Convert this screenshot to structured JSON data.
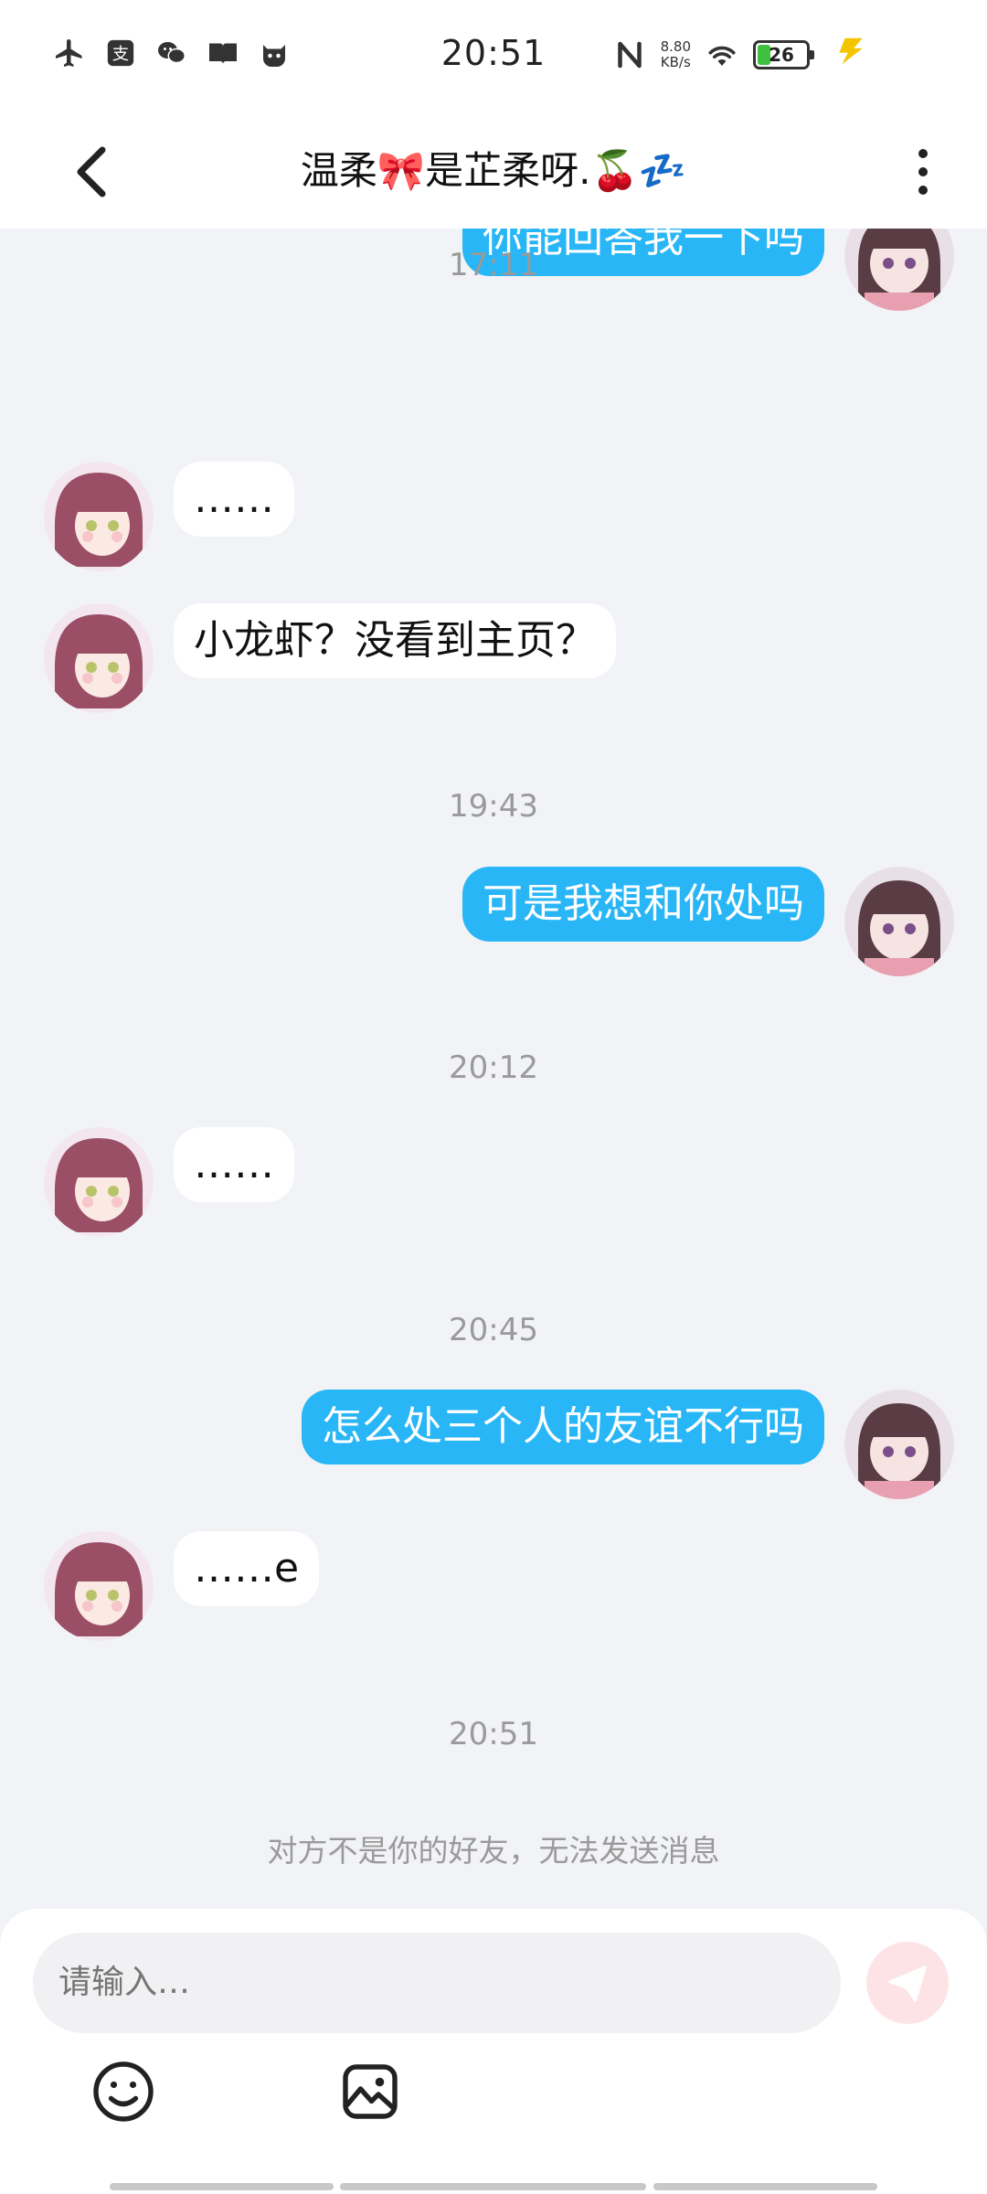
{
  "status_bar": {
    "time": "20:51",
    "net_speed_value": "8.80",
    "net_speed_unit": "KB/s",
    "battery_level": "26",
    "icons": [
      "airplane-mode-icon",
      "alipay-icon",
      "wechat-icon",
      "book-icon",
      "cat-icon",
      "nfc-icon",
      "wifi-icon",
      "battery-icon",
      "charging-bolt-icon"
    ]
  },
  "header": {
    "title": "温柔🎀是芷柔呀.🍒💤"
  },
  "messages": [
    {
      "side": "out",
      "text": "你能回答我一下吗"
    },
    {
      "timestamp": "17:11"
    },
    {
      "side": "in",
      "text": "……"
    },
    {
      "side": "in",
      "text": "小龙虾？没看到主页？"
    },
    {
      "timestamp": "19:43"
    },
    {
      "side": "out",
      "text": "可是我想和你处吗"
    },
    {
      "timestamp": "20:12"
    },
    {
      "side": "in",
      "text": "……"
    },
    {
      "timestamp": "20:45"
    },
    {
      "side": "out",
      "text": "怎么处三个人的友谊不行吗"
    },
    {
      "side": "in",
      "text": "……e"
    },
    {
      "timestamp": "20:51"
    }
  ],
  "notice": "对方不是你的好友，无法发送消息",
  "composer": {
    "placeholder": "请输入…",
    "send_icon": "send-icon",
    "tools": [
      "emoji-icon",
      "image-icon"
    ]
  },
  "colors": {
    "outgoing_bubble": "#28b6f6",
    "incoming_bubble": "#ffffff",
    "background": "#f2f3f6",
    "send_button": "#fde3e6"
  }
}
